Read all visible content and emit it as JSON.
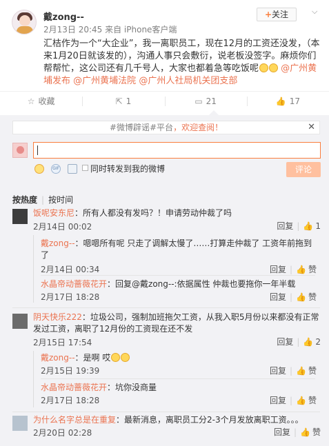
{
  "post": {
    "author": "戴zong--",
    "meta": "2月13日 20:45 来自 iPhone客户端",
    "follow_label": "关注",
    "text_main": "汇桔作为一个“大企业”，我一离职员工，现在12月的工资还没发，（本来1月20日就该发的），沟通人事只会敷衍，说老板没签字。麻烦你们帮帮忙，这公司还有几千号人，大家也都着急等吃饭呢",
    "mentions": [
      "@广州黄埔发布",
      "@广州黄埔法院",
      "@广州人社局机关团支部"
    ]
  },
  "actions": {
    "favorite_label": "收藏",
    "repost_count": "1",
    "comment_count": "21",
    "like_count": "17"
  },
  "notice": {
    "tag1": "#微博辟谣#",
    "tag2": "平台",
    "highlight": "，欢迎查阅！",
    "close": "✕"
  },
  "composer": {
    "placeholder": "",
    "repost_label": "同时转发到我的微博",
    "submit_label": "评论"
  },
  "sort": {
    "hot": "按热度",
    "time": "按时间"
  },
  "comments": [
    {
      "nick": "饭呢安东尼",
      "text": "：所有人都没有发吗？！申请劳动仲裁了吗",
      "time": "2月14日 00:02",
      "reply": "回复",
      "likes": "1",
      "replies": [
        {
          "nick": "戴zong--",
          "text": "：嗯嗯所有呢 只走了调解太慢了……打算走仲裁了 工资年前拖到了",
          "time": "2月14日 00:34",
          "reply": "回复",
          "likes": "赞"
        },
        {
          "nick": "水晶帝动蔷薇花开",
          "text": "：回复@戴zong--:依据属性 仲裁也要拖你一年半载",
          "time": "2月17日 18:28",
          "reply": "回复",
          "likes": "赞"
        }
      ]
    },
    {
      "nick": "阴天快乐222",
      "text": "：垃圾公司，强制加班拖欠工资，从我入职5月份以来都没有正常发过工资，离职了12月份的工资现在还不发",
      "time": "2月15日 17:54",
      "reply": "回复",
      "likes": "2",
      "replies": [
        {
          "nick": "戴zong--",
          "text": "：是啊 哎",
          "time": "2月15日 19:39",
          "reply": "回复",
          "likes": "赞"
        },
        {
          "nick": "水晶帝动蔷薇花开",
          "text": "：坑你没商量",
          "time": "2月17日 18:28",
          "reply": "回复",
          "likes": "赞"
        }
      ]
    },
    {
      "nick": "为什么名字总是在重复",
      "text": "：最新消息，离职员工分2-3个月发放离职工资。。。",
      "time": "2月20日 02:28",
      "reply": "回复",
      "likes": "赞",
      "replies": []
    }
  ]
}
